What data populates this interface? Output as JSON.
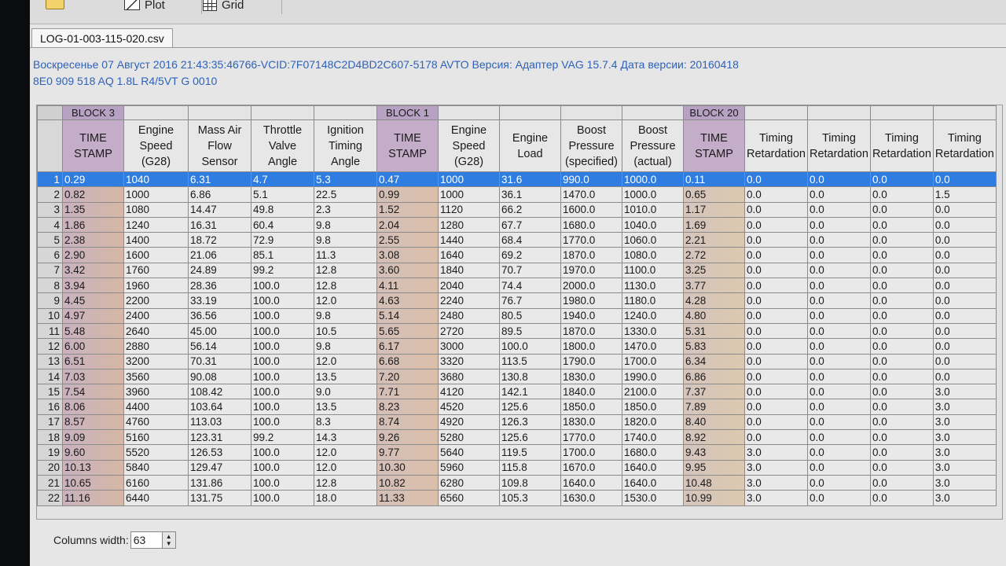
{
  "toolbar": {
    "plot_label": "Plot",
    "grid_label": "Grid"
  },
  "file_tab": "LOG-01-003-115-020.csv",
  "info": {
    "line1": "Воскресенье 07 Август 2016 21:43:35:46766-VCID:7F07148C2D4BD2C607-5178 AVTO Версия: Адаптер VAG 15.7.4 Дата версии: 20160418",
    "line2": "8E0 909 518 AQ  1.8L R4/5VT    G  0010"
  },
  "blocks": [
    "BLOCK 3",
    "BLOCK 1",
    "BLOCK 20"
  ],
  "headers": [
    "TIME STAMP",
    "Engine Speed (G28)",
    "Mass Air Flow Sensor",
    "Throttle Valve Angle",
    "Ignition Timing Angle",
    "TIME STAMP",
    "Engine Speed (G28)",
    "Engine Load",
    "Boost Pressure (specified)",
    "Boost Pressure (actual)",
    "TIME STAMP",
    "Timing Retardation",
    "Timing Retardation",
    "Timing Retardation",
    "Timing Retardation"
  ],
  "rows": [
    [
      "0.29",
      "1040",
      "6.31",
      "4.7",
      "5.3",
      "0.47",
      "1000",
      "31.6",
      "990.0",
      "1000.0",
      "0.11",
      "0.0",
      "0.0",
      "0.0",
      "0.0"
    ],
    [
      "0.82",
      "1000",
      "6.86",
      "5.1",
      "22.5",
      "0.99",
      "1000",
      "36.1",
      "1470.0",
      "1000.0",
      "0.65",
      "0.0",
      "0.0",
      "0.0",
      "1.5"
    ],
    [
      "1.35",
      "1080",
      "14.47",
      "49.8",
      "2.3",
      "1.52",
      "1120",
      "66.2",
      "1600.0",
      "1010.0",
      "1.17",
      "0.0",
      "0.0",
      "0.0",
      "0.0"
    ],
    [
      "1.86",
      "1240",
      "16.31",
      "60.4",
      "9.8",
      "2.04",
      "1280",
      "67.7",
      "1680.0",
      "1040.0",
      "1.69",
      "0.0",
      "0.0",
      "0.0",
      "0.0"
    ],
    [
      "2.38",
      "1400",
      "18.72",
      "72.9",
      "9.8",
      "2.55",
      "1440",
      "68.4",
      "1770.0",
      "1060.0",
      "2.21",
      "0.0",
      "0.0",
      "0.0",
      "0.0"
    ],
    [
      "2.90",
      "1600",
      "21.06",
      "85.1",
      "11.3",
      "3.08",
      "1640",
      "69.2",
      "1870.0",
      "1080.0",
      "2.72",
      "0.0",
      "0.0",
      "0.0",
      "0.0"
    ],
    [
      "3.42",
      "1760",
      "24.89",
      "99.2",
      "12.8",
      "3.60",
      "1840",
      "70.7",
      "1970.0",
      "1100.0",
      "3.25",
      "0.0",
      "0.0",
      "0.0",
      "0.0"
    ],
    [
      "3.94",
      "1960",
      "28.36",
      "100.0",
      "12.8",
      "4.11",
      "2040",
      "74.4",
      "2000.0",
      "1130.0",
      "3.77",
      "0.0",
      "0.0",
      "0.0",
      "0.0"
    ],
    [
      "4.45",
      "2200",
      "33.19",
      "100.0",
      "12.0",
      "4.63",
      "2240",
      "76.7",
      "1980.0",
      "1180.0",
      "4.28",
      "0.0",
      "0.0",
      "0.0",
      "0.0"
    ],
    [
      "4.97",
      "2400",
      "36.56",
      "100.0",
      "9.8",
      "5.14",
      "2480",
      "80.5",
      "1940.0",
      "1240.0",
      "4.80",
      "0.0",
      "0.0",
      "0.0",
      "0.0"
    ],
    [
      "5.48",
      "2640",
      "45.00",
      "100.0",
      "10.5",
      "5.65",
      "2720",
      "89.5",
      "1870.0",
      "1330.0",
      "5.31",
      "0.0",
      "0.0",
      "0.0",
      "0.0"
    ],
    [
      "6.00",
      "2880",
      "56.14",
      "100.0",
      "9.8",
      "6.17",
      "3000",
      "100.0",
      "1800.0",
      "1470.0",
      "5.83",
      "0.0",
      "0.0",
      "0.0",
      "0.0"
    ],
    [
      "6.51",
      "3200",
      "70.31",
      "100.0",
      "12.0",
      "6.68",
      "3320",
      "113.5",
      "1790.0",
      "1700.0",
      "6.34",
      "0.0",
      "0.0",
      "0.0",
      "0.0"
    ],
    [
      "7.03",
      "3560",
      "90.08",
      "100.0",
      "13.5",
      "7.20",
      "3680",
      "130.8",
      "1830.0",
      "1990.0",
      "6.86",
      "0.0",
      "0.0",
      "0.0",
      "0.0"
    ],
    [
      "7.54",
      "3960",
      "108.42",
      "100.0",
      "9.0",
      "7.71",
      "4120",
      "142.1",
      "1840.0",
      "2100.0",
      "7.37",
      "0.0",
      "0.0",
      "0.0",
      "3.0"
    ],
    [
      "8.06",
      "4400",
      "103.64",
      "100.0",
      "13.5",
      "8.23",
      "4520",
      "125.6",
      "1850.0",
      "1850.0",
      "7.89",
      "0.0",
      "0.0",
      "0.0",
      "3.0"
    ],
    [
      "8.57",
      "4760",
      "113.03",
      "100.0",
      "8.3",
      "8.74",
      "4920",
      "126.3",
      "1830.0",
      "1820.0",
      "8.40",
      "0.0",
      "0.0",
      "0.0",
      "3.0"
    ],
    [
      "9.09",
      "5160",
      "123.31",
      "99.2",
      "14.3",
      "9.26",
      "5280",
      "125.6",
      "1770.0",
      "1740.0",
      "8.92",
      "0.0",
      "0.0",
      "0.0",
      "3.0"
    ],
    [
      "9.60",
      "5520",
      "126.53",
      "100.0",
      "12.0",
      "9.77",
      "5640",
      "119.5",
      "1700.0",
      "1680.0",
      "9.43",
      "3.0",
      "0.0",
      "0.0",
      "3.0"
    ],
    [
      "10.13",
      "5840",
      "129.47",
      "100.0",
      "12.0",
      "10.30",
      "5960",
      "115.8",
      "1670.0",
      "1640.0",
      "9.95",
      "3.0",
      "0.0",
      "0.0",
      "3.0"
    ],
    [
      "10.65",
      "6160",
      "131.86",
      "100.0",
      "12.8",
      "10.82",
      "6280",
      "109.8",
      "1640.0",
      "1640.0",
      "10.48",
      "3.0",
      "0.0",
      "0.0",
      "3.0"
    ],
    [
      "11.16",
      "6440",
      "131.75",
      "100.0",
      "18.0",
      "11.33",
      "6560",
      "105.3",
      "1630.0",
      "1530.0",
      "10.99",
      "3.0",
      "0.0",
      "0.0",
      "3.0"
    ]
  ],
  "selected_row": 1,
  "footer": {
    "columns_width_label": "Columns width:",
    "columns_width_value": "63"
  },
  "colors": {
    "selection": "#2f7de1",
    "timestamp_header": "#c4adc9",
    "info_text": "#2d62b8"
  }
}
